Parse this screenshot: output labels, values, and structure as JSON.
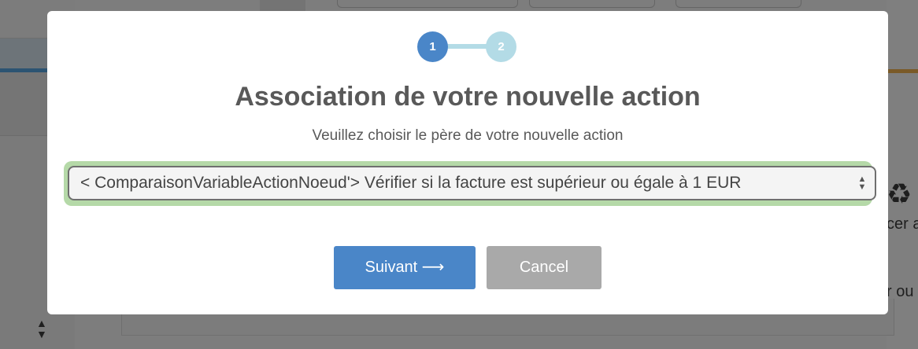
{
  "modal": {
    "steps": [
      {
        "number": "1",
        "state": "active"
      },
      {
        "number": "2",
        "state": "inactive"
      }
    ],
    "title": "Association de votre nouvelle action",
    "subtitle": "Veuillez choisir le père de votre nouvelle action",
    "parent_select": {
      "selected_value": "< ComparaisonVariableActionNoeud'> Vérifier si la facture est supérieur ou égale à 1 EUR"
    },
    "buttons": {
      "next_label": "Suivant ⟶",
      "cancel_label": "Cancel"
    }
  },
  "background": {
    "right_text_1": "cer a",
    "right_text_2": "r ou",
    "right_icon": "recycle-icon"
  },
  "colors": {
    "primary": "#4a86c8",
    "step_inactive": "#b3dbe6",
    "cancel": "#a9a9a9",
    "select_focus_ring": "#b5d9a8",
    "text": "#595959"
  }
}
